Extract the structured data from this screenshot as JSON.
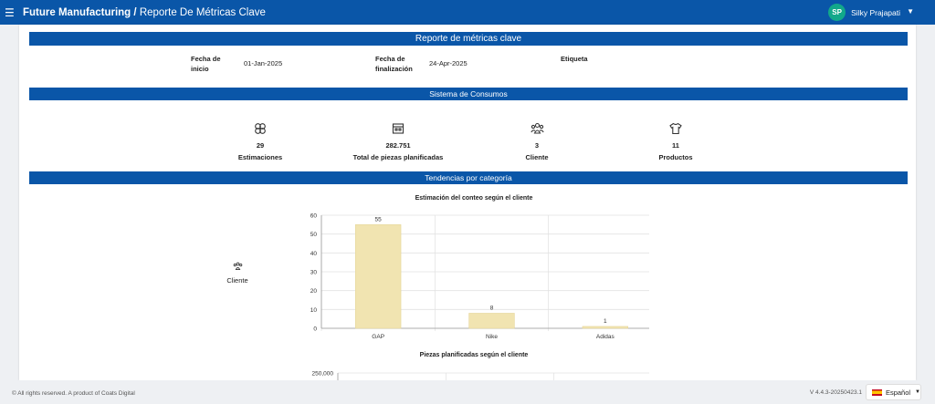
{
  "header": {
    "org": "Future Manufacturing",
    "separator": "/",
    "page": "Reporte De Métricas Clave",
    "user_initials": "SP",
    "user_name": "Silky Prajapati"
  },
  "report": {
    "title": "Reporte de métricas clave",
    "start_label": "Fecha de inicio",
    "start_value": "01-Jan-2025",
    "end_label": "Fecha de finalización",
    "end_value": "24-Apr-2025",
    "tag_label": "Etiqueta"
  },
  "consumption": {
    "title": "Sistema de Consumos",
    "metrics": [
      {
        "icon": "estimations-icon",
        "value": "29",
        "label": "Estimaciones"
      },
      {
        "icon": "factory-icon",
        "value": "282.751",
        "label": "Total de piezas planificadas"
      },
      {
        "icon": "clients-icon",
        "value": "3",
        "label": "Cliente"
      },
      {
        "icon": "tshirt-icon",
        "value": "11",
        "label": "Productos"
      }
    ]
  },
  "trends": {
    "title": "Tendencias por categoría",
    "side_label": "Cliente"
  },
  "chart_data": [
    {
      "type": "bar",
      "title": "Estimación del conteo según el cliente",
      "categories": [
        "GAP",
        "Nike",
        "Adidas"
      ],
      "values": [
        55,
        8,
        1
      ],
      "ylim": [
        0,
        60
      ],
      "yticks": [
        "0",
        "10",
        "20",
        "30",
        "40",
        "50",
        "60"
      ],
      "color": "#f1e4b1",
      "grid": true
    },
    {
      "type": "bar",
      "title": "Piezas planificadas según el cliente",
      "yticks": [
        "250,000"
      ],
      "grid": true
    }
  ],
  "footer": {
    "copyright": "© All rights reserved. A product of Coats Digital",
    "version": "V 4.4.3-20250423.1",
    "language": "Español"
  }
}
